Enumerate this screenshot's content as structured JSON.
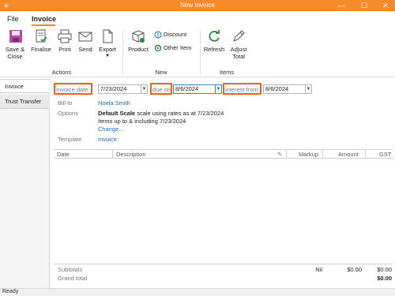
{
  "window": {
    "title": "New Invoice",
    "minimize": "—",
    "maximize": "☐",
    "close": "✕"
  },
  "menu": {
    "file": "File",
    "invoice": "Invoice"
  },
  "ribbon": {
    "actions": {
      "save_close": "Save & Close",
      "finalise": "Finalise",
      "print": "Print",
      "send": "Send",
      "export": "Export",
      "group": "Actions"
    },
    "new": {
      "product": "Product",
      "discount": "Discount",
      "other_item": "Other Item",
      "group": "New"
    },
    "items": {
      "refresh": "Refresh",
      "adjust_total": "Adjust Total",
      "group": "Items"
    }
  },
  "side_tabs": {
    "invoice": "Invoice",
    "trust_transfer": "Trust Transfer"
  },
  "form": {
    "invoice_date_label": "Invoice date",
    "invoice_date": "7/23/2024",
    "due_on_label": "due on",
    "due_on": "8/6/2024",
    "interest_from_label": "interest from",
    "interest_from": "8/6/2024",
    "bill_to_label": "Bill to",
    "bill_to": "Noela Smith",
    "options_label": "Options",
    "options_line1_bold": "Default Scale",
    "options_line1_rest": " scale using rates as at 7/23/2024",
    "options_line2": "Items up to & including 7/23/2024",
    "change_link": "Change...",
    "template_label": "Template",
    "template_value": "Invoice"
  },
  "grid": {
    "columns": [
      "Date",
      "Description",
      "Markup",
      "Amount",
      "GST"
    ]
  },
  "totals": {
    "subtotals_label": "Subtotals",
    "subtotals_markup": "Nil",
    "subtotals_amount": "$0.00",
    "subtotals_gst": "$0.00",
    "grand_total_label": "Grand total",
    "grand_total": "$0.00"
  },
  "status": {
    "text": "Ready"
  },
  "colors": {
    "accent": "#f78a2a",
    "highlight": "#f2621a",
    "link": "#1e6fc4"
  }
}
